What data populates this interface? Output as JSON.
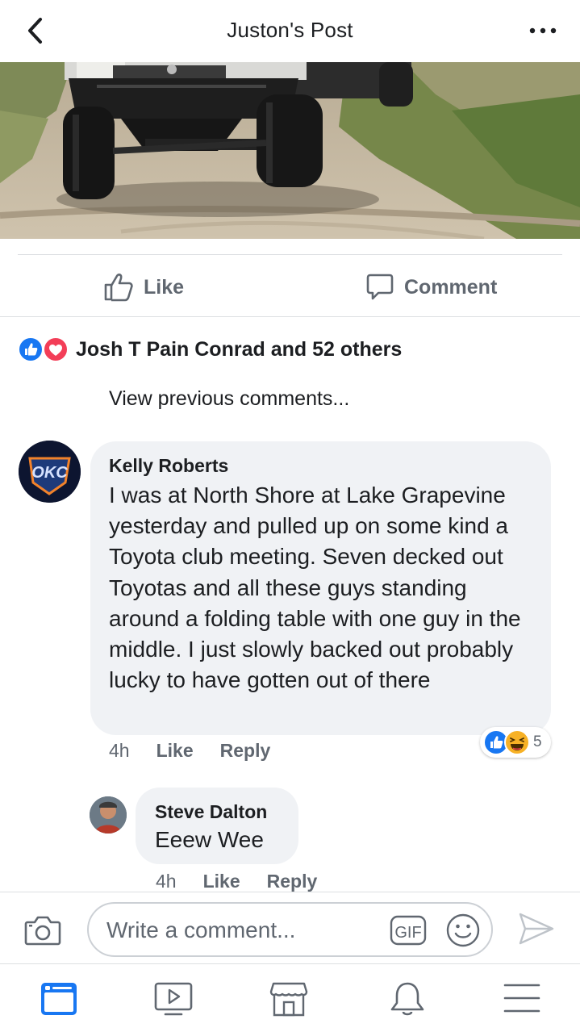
{
  "header": {
    "title": "Juston's Post"
  },
  "actions": {
    "like_label": "Like",
    "comment_label": "Comment"
  },
  "reactions": {
    "summary": "Josh T Pain Conrad and 52 others"
  },
  "comments_link": "View previous comments...",
  "comments": [
    {
      "name": "Kelly Roberts",
      "text": "I was at North Shore at Lake Grapevine yesterday and pulled up on some kind a Toyota club meeting. Seven decked out Toyotas and all these guys standing around a folding table with one guy in the middle. I just slowly backed out probably lucky to have gotten out of there",
      "time": "4h",
      "like_label": "Like",
      "reply_label": "Reply",
      "reaction_count": "5",
      "avatar_text": "OKC"
    },
    {
      "name": "Steve Dalton",
      "text": "Eeew Wee",
      "time": "4h",
      "like_label": "Like",
      "reply_label": "Reply"
    }
  ],
  "composer": {
    "placeholder": "Write a comment...",
    "gif_label": "GIF"
  },
  "colors": {
    "like_blue": "#1877f2",
    "love_red": "#f33e58",
    "haha_yellow": "#f7b125",
    "accent": "#1877f2"
  },
  "nav": [
    "news-feed-icon",
    "watch-icon",
    "marketplace-icon",
    "notifications-icon",
    "menu-icon"
  ]
}
